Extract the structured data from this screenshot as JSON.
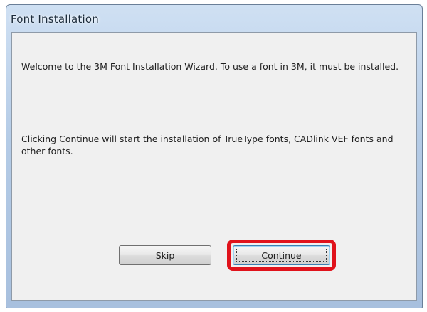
{
  "window": {
    "title": "Font Installation"
  },
  "content": {
    "welcome_message": "Welcome to the 3M Font Installation Wizard.  To use a font in 3M, it must be installed.",
    "info_message": "Clicking Continue will start the installation of TrueType fonts, CADlink VEF fonts and other fonts."
  },
  "buttons": {
    "skip_label": "Skip",
    "continue_label": "Continue"
  },
  "annotation": {
    "highlight_target": "continue-button",
    "highlight_color": "#e0121b"
  },
  "colors": {
    "title_bar": "#b4cbe6",
    "client_background": "#f0f0f0"
  }
}
